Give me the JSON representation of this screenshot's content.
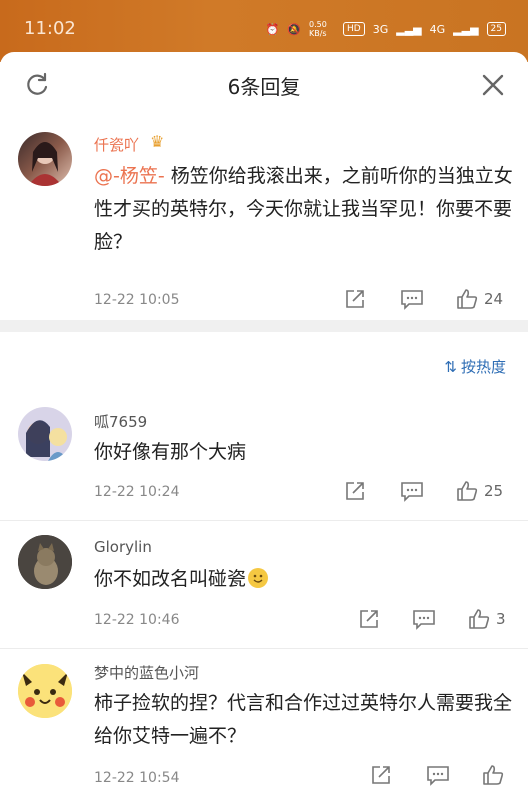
{
  "status": {
    "time": "11:02",
    "net_speed": "0.50 KB/s",
    "hd": "HD",
    "sig1": "3G",
    "sig2": "4G",
    "battery": "25"
  },
  "header": {
    "title": "6条回复"
  },
  "main": {
    "username": "仟瓷吖",
    "mention": "@-杨笠-",
    "text": " 杨笠你给我滚出来，之前听你的当独立女性才买的英特尔，今天你就让我当罕见！你要不要脸？",
    "time": "12-22 10:05",
    "likes": "24"
  },
  "sort_label": "按热度",
  "replies": [
    {
      "username": "呱7659",
      "text": "你好像有那个大病",
      "time": "12-22 10:24",
      "likes": "25"
    },
    {
      "username": "Glorylin",
      "text": "你不如改名叫碰瓷",
      "time": "12-22 10:46",
      "likes": "3"
    },
    {
      "username": "梦中的蓝色小河",
      "text": "柿子捡软的捏？代言和合作过过英特尔人需要我全给你艾特一遍不？",
      "time": "12-22 10:54",
      "likes": ""
    }
  ],
  "colors": {
    "mention": "#eb7350",
    "sort": "#2f6eb5",
    "status_bar": "#cc7020"
  }
}
